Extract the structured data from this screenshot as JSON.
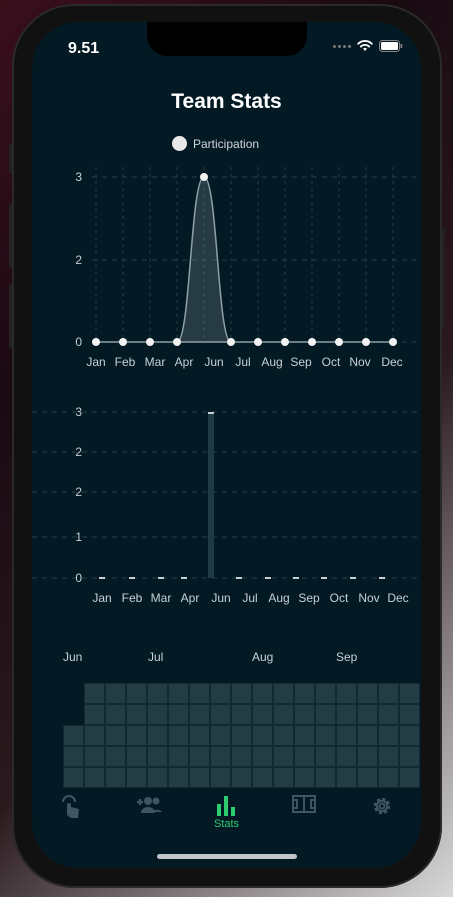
{
  "status": {
    "time": "9.51"
  },
  "header": {
    "title": "Team Stats"
  },
  "legend": {
    "label": "Participation",
    "color": "#e8e8e8"
  },
  "chart_data": [
    {
      "type": "area",
      "series": [
        {
          "name": "Participation",
          "values": [
            0,
            0,
            0,
            0,
            3,
            0,
            0,
            0,
            0,
            0,
            0,
            0
          ]
        }
      ],
      "x_tick_labels": [
        "Jan",
        "Feb",
        "Mar",
        "Apr",
        "Jun",
        "Jul",
        "Aug",
        "Sep",
        "Oct",
        "Nov",
        "Dec"
      ],
      "y_tick_labels": [
        "3",
        "2",
        "0"
      ],
      "ylim": [
        0,
        3
      ],
      "grid": true,
      "legend": "top-center"
    },
    {
      "type": "bar",
      "categories": [
        "Jan",
        "Feb",
        "Mar",
        "Apr",
        "Jun",
        "Jul",
        "Aug",
        "Sep",
        "Oct",
        "Nov",
        "Dec"
      ],
      "values": [
        0,
        0,
        0,
        0,
        3,
        0,
        0,
        0,
        0,
        0,
        0
      ],
      "y_tick_labels": [
        "3",
        "2",
        "2",
        "1",
        "0"
      ],
      "ylim": [
        0,
        3
      ],
      "grid": true
    }
  ],
  "calendar": {
    "months": [
      "Jun",
      "Jul",
      "Aug",
      "Sep"
    ]
  },
  "tabs": [
    {
      "icon": "tap-icon",
      "label": ""
    },
    {
      "icon": "add-team-icon",
      "label": ""
    },
    {
      "icon": "stats-icon",
      "label": "Stats",
      "active": true
    },
    {
      "icon": "field-icon",
      "label": ""
    },
    {
      "icon": "gear-icon",
      "label": ""
    }
  ],
  "colors": {
    "accent": "#2ecc71",
    "background": "#031a24",
    "cell": "#243d45"
  }
}
